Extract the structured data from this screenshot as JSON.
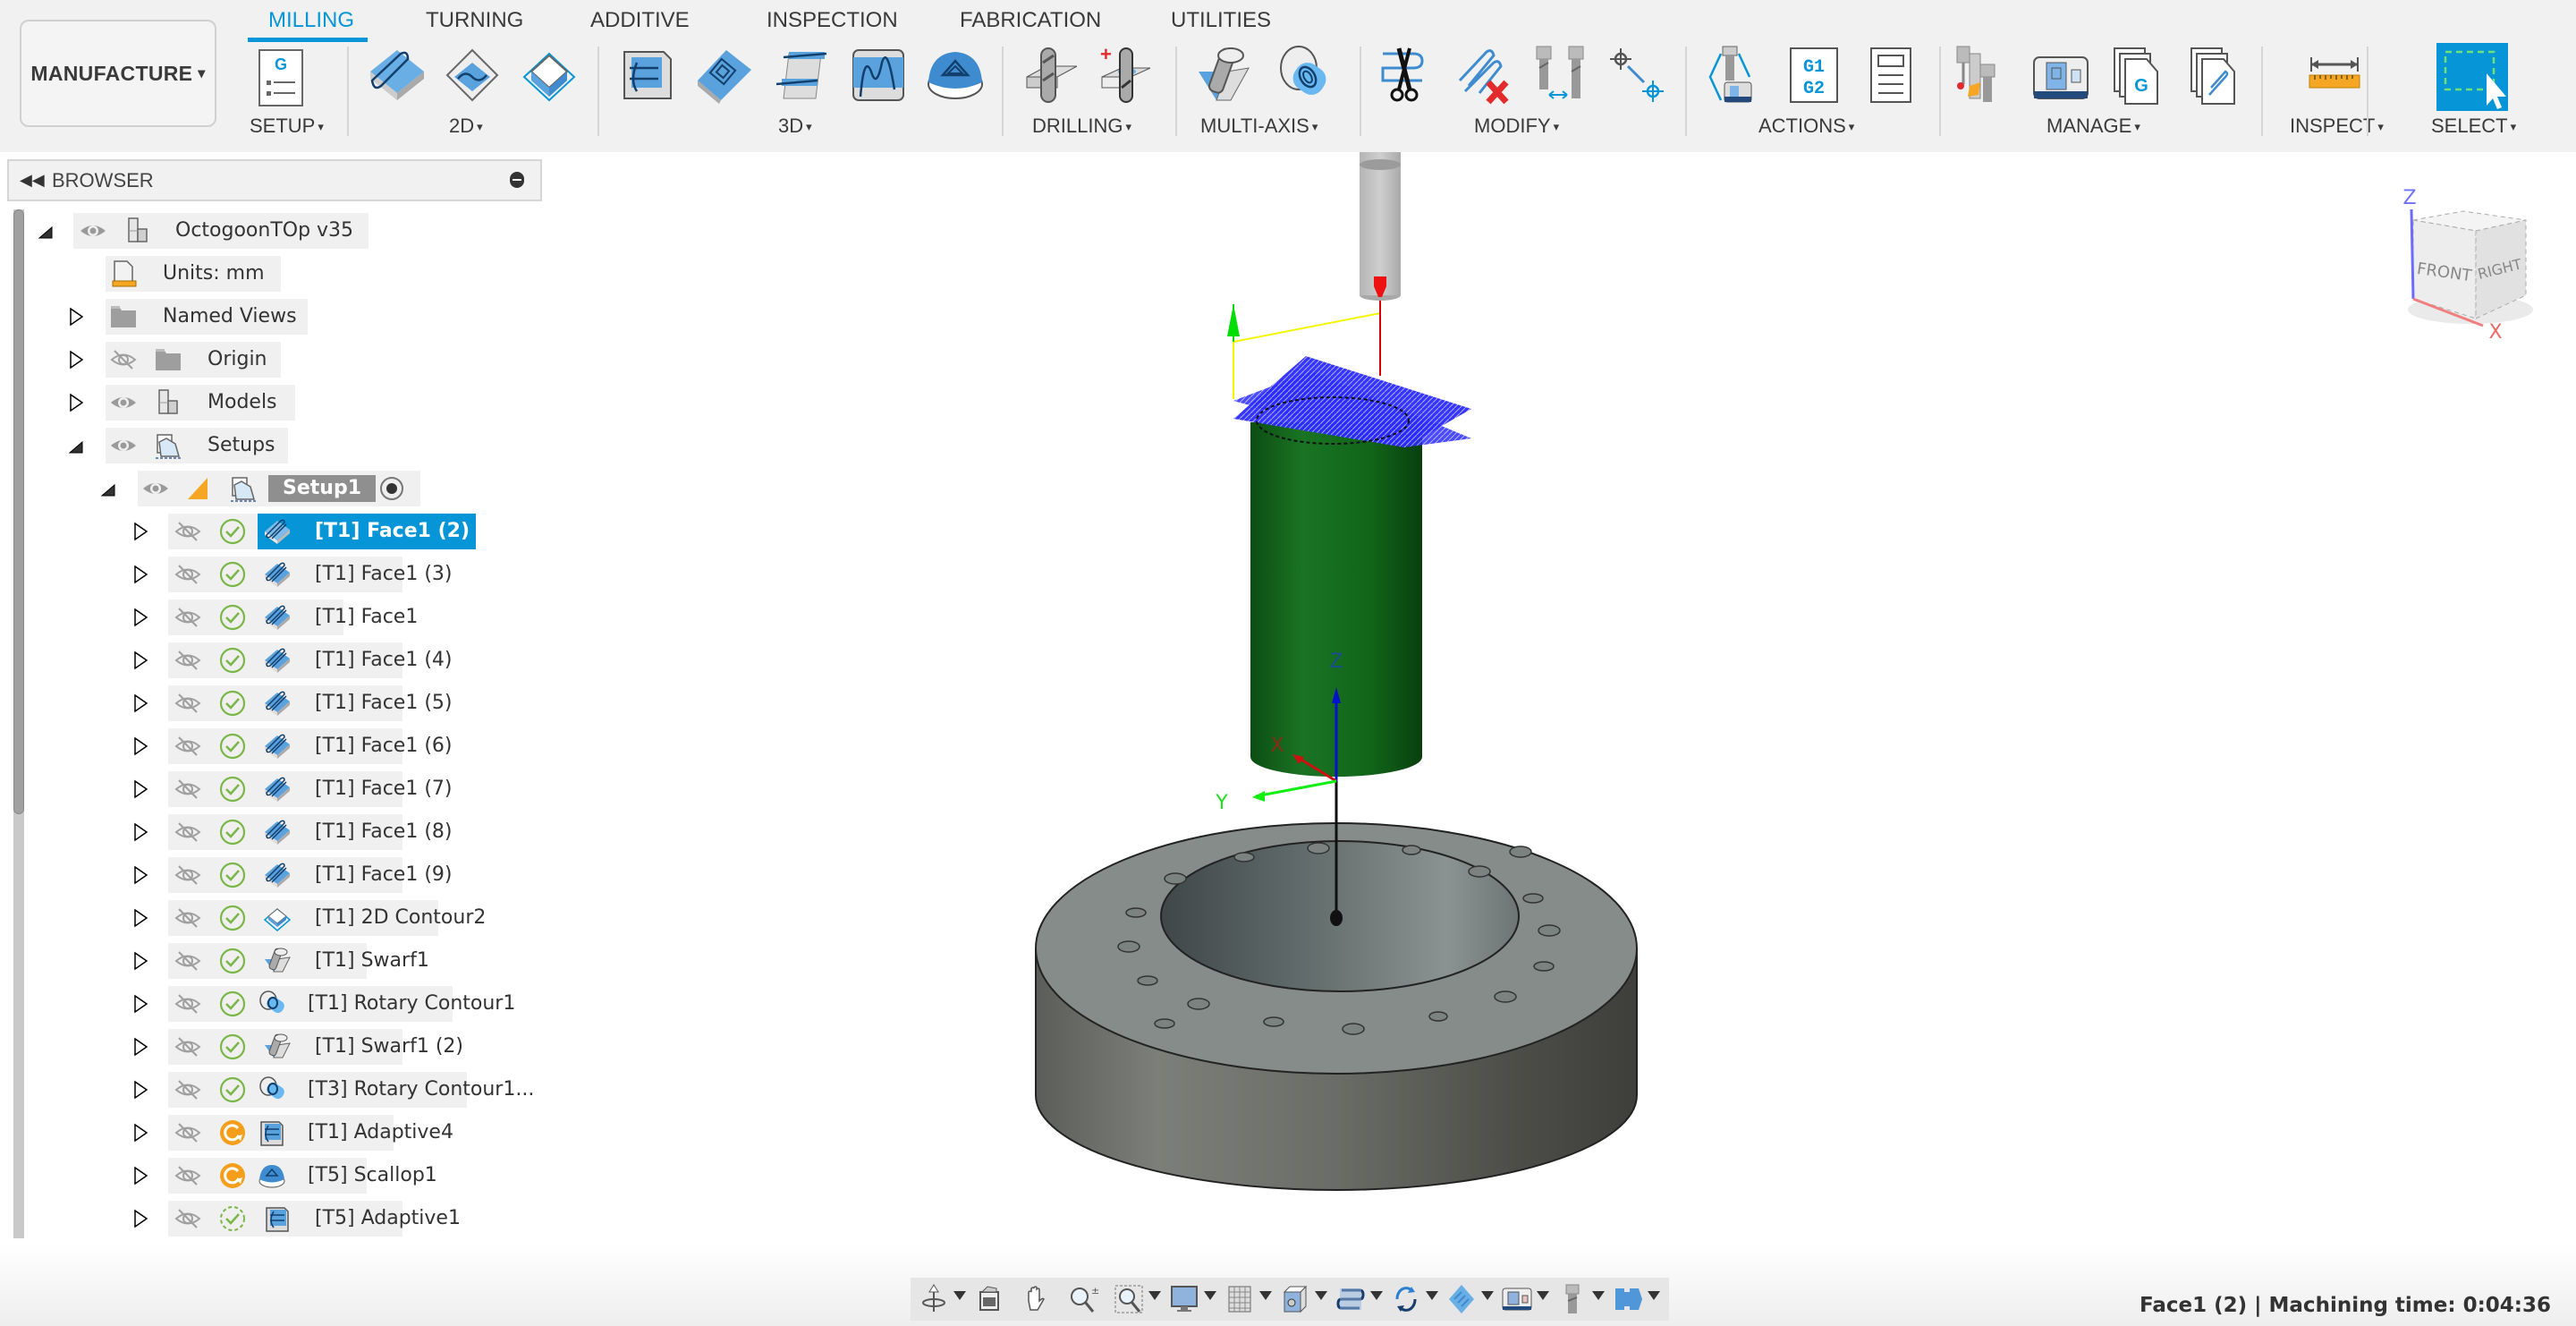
{
  "workspace": {
    "label": "MANUFACTURE",
    "caret": "▾"
  },
  "tabs": [
    {
      "label": "MILLING",
      "active": true
    },
    {
      "label": "TURNING",
      "active": false
    },
    {
      "label": "ADDITIVE",
      "active": false
    },
    {
      "label": "INSPECTION",
      "active": false
    },
    {
      "label": "FABRICATION",
      "active": false
    },
    {
      "label": "UTILITIES",
      "active": false
    }
  ],
  "ribbon_groups": [
    {
      "label": "SETUP",
      "tools": [
        "setup-icon"
      ]
    },
    {
      "label": "2D",
      "tools": [
        "2d-adaptive-icon",
        "2d-pocket-icon",
        "2d-contour-icon"
      ]
    },
    {
      "label": "3D",
      "tools": [
        "3d-adaptive-icon",
        "3d-pocket-icon",
        "3d-steep-shallow-icon",
        "3d-flow-icon",
        "3d-scallop-icon"
      ]
    },
    {
      "label": "DRILLING",
      "tools": [
        "drill-icon",
        "hole-recognition-icon"
      ]
    },
    {
      "label": "MULTI-AXIS",
      "tools": [
        "swarf-icon",
        "rotary-icon"
      ]
    },
    {
      "label": "MODIFY",
      "tools": [
        "trim-icon",
        "delete-toolpath-icon",
        "tool-compare-icon",
        "move-point-icon"
      ]
    },
    {
      "label": "ACTIONS",
      "tools": [
        "simulate-icon",
        "post-process-icon",
        "setup-sheet-icon"
      ]
    },
    {
      "label": "MANAGE",
      "tools": [
        "tool-library-icon",
        "machine-library-icon",
        "post-library-icon",
        "template-library-icon"
      ]
    },
    {
      "label": "INSPECT",
      "tools": [
        "measure-icon"
      ]
    },
    {
      "label": "SELECT",
      "tools": [
        "select-window-icon"
      ]
    }
  ],
  "dropdown_caret": "▾",
  "browser": {
    "title": "BROWSER",
    "collapse_glyph": "◂◂",
    "root": {
      "label": "OctogoonTOp v35"
    },
    "units": {
      "label": "Units: mm"
    },
    "folders": [
      {
        "label": "Named Views",
        "visible": null
      },
      {
        "label": "Origin",
        "visible": false
      },
      {
        "label": "Models",
        "visible": true
      },
      {
        "label": "Setups",
        "visible": true
      }
    ],
    "setup": {
      "label": "Setup1"
    },
    "operations": [
      {
        "label": "[T1] Face1 (2)",
        "status": "valid",
        "type": "face",
        "selected": true
      },
      {
        "label": "[T1] Face1 (3)",
        "status": "valid",
        "type": "face"
      },
      {
        "label": "[T1] Face1",
        "status": "valid",
        "type": "face"
      },
      {
        "label": "[T1] Face1 (4)",
        "status": "valid",
        "type": "face"
      },
      {
        "label": "[T1] Face1 (5)",
        "status": "valid",
        "type": "face"
      },
      {
        "label": "[T1] Face1 (6)",
        "status": "valid",
        "type": "face"
      },
      {
        "label": "[T1] Face1 (7)",
        "status": "valid",
        "type": "face"
      },
      {
        "label": "[T1] Face1 (8)",
        "status": "valid",
        "type": "face"
      },
      {
        "label": "[T1] Face1 (9)",
        "status": "valid",
        "type": "face"
      },
      {
        "label": "[T1] 2D Contour2",
        "status": "valid",
        "type": "contour2d"
      },
      {
        "label": "[T1] Swarf1",
        "status": "valid",
        "type": "swarf"
      },
      {
        "label": "[T1] Rotary Contour1",
        "status": "valid",
        "type": "rotary"
      },
      {
        "label": "[T1] Swarf1 (2)",
        "status": "valid",
        "type": "swarf"
      },
      {
        "label": "[T3] Rotary Contour1...",
        "status": "valid",
        "type": "rotary"
      },
      {
        "label": "[T1] Adaptive4",
        "status": "outdated",
        "type": "adaptive"
      },
      {
        "label": "[T5] Scallop1",
        "status": "outdated",
        "type": "scallop"
      },
      {
        "label": "[T5] Adaptive1",
        "status": "pending",
        "type": "adaptive"
      }
    ]
  },
  "viewcube": {
    "front": "FRONT",
    "right": "RIGHT",
    "axis_z": "Z",
    "axis_x": "X"
  },
  "triad": {
    "z": "Z",
    "x": "X",
    "y": "Y"
  },
  "navbar": {
    "tools": [
      "orbit-icon",
      "look-at-icon",
      "pan-icon",
      "zoom-icon",
      "zoom-window-icon",
      "display-settings-icon",
      "grid-icon",
      "viewports-icon",
      "toolpath-display-icon",
      "rotate-icon",
      "stock-icon",
      "machine-icon",
      "tool-display-icon",
      "fixture-icon"
    ]
  },
  "status": {
    "text": "Face1 (2) | Machining time: 0:04:36"
  },
  "colors": {
    "accent": "#0696d7",
    "valid": "#7ab648",
    "outdated": "#f59e1b",
    "stock": "#0f6319",
    "part": "#6e716c"
  }
}
